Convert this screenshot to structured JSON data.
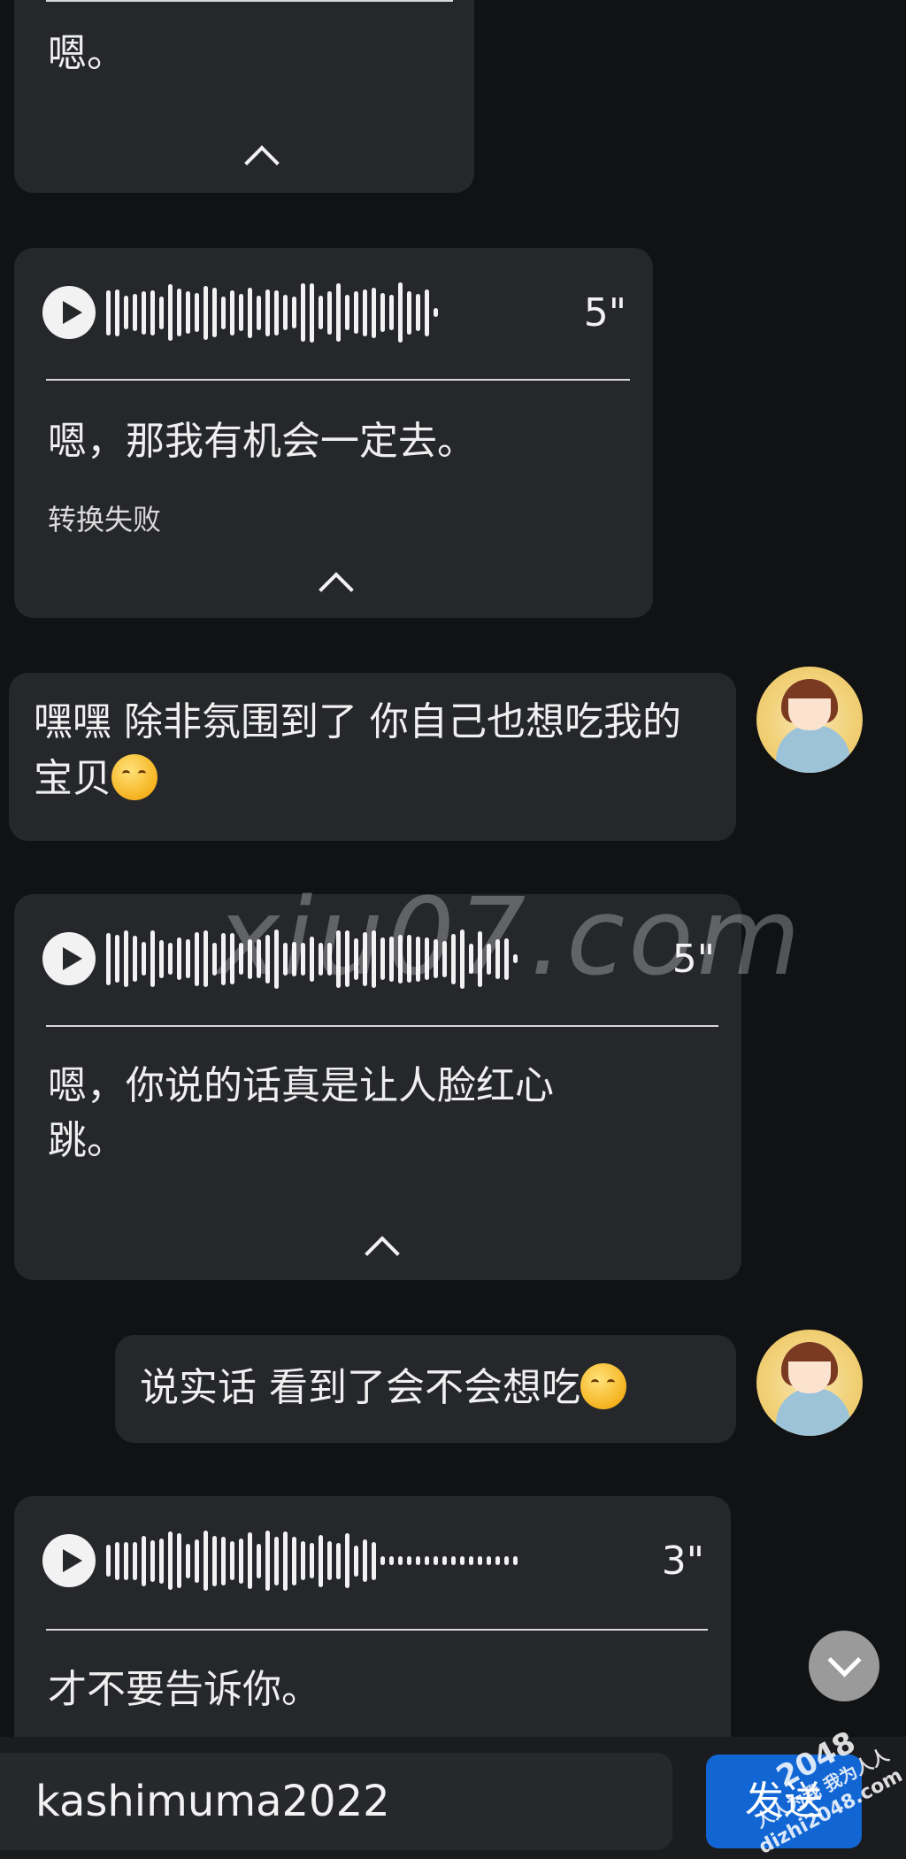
{
  "messages": [
    {
      "transcript": "嗯。"
    },
    {
      "duration": "5\"",
      "transcript": "嗯，那我有机会一定去。",
      "status": "转换失败"
    },
    {
      "text": "嘿嘿 除非氛围到了  你自己也想吃我的宝贝",
      "emoji": "yawning-face-emoji"
    },
    {
      "duration": "5\"",
      "transcript_line1": "嗯，你说的话真是让人脸红心",
      "transcript_line2": "跳。"
    },
    {
      "text": "说实话  看到了会不会想吃",
      "emoji": "yawning-face-emoji"
    },
    {
      "duration": "3\"",
      "transcript": "才不要告诉你。"
    }
  ],
  "watermark": "xiu07.com",
  "composer": {
    "input_value": "kashimuma2022",
    "send_label": "发送"
  },
  "logo": {
    "number": "2048",
    "slogan": "人人为我 我为人人",
    "site": "dizhi2048.com"
  },
  "colors": {
    "background": "#111214",
    "bubble": "#26272B",
    "send": "#1266D4"
  }
}
